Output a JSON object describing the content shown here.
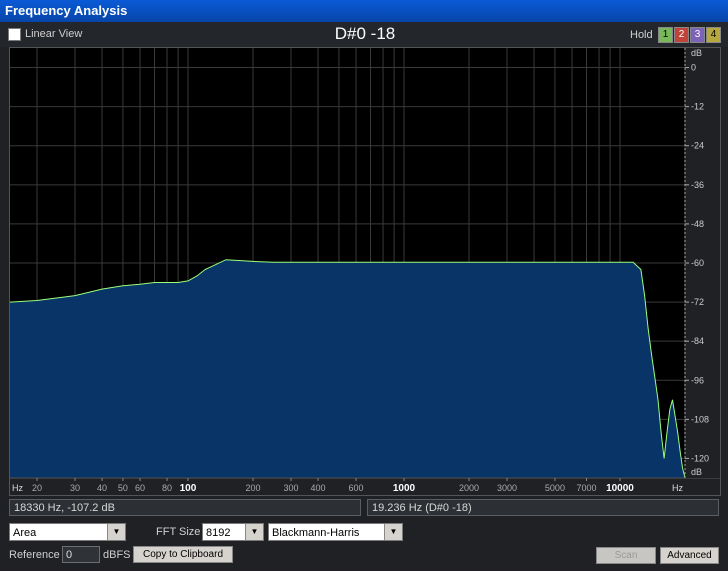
{
  "window": {
    "title": "Frequency Analysis"
  },
  "toolbar": {
    "linear_view_label": "Linear View",
    "note_readout": "D#0 -18",
    "hold_label": "Hold",
    "hold_buttons": [
      "1",
      "2",
      "3",
      "4"
    ]
  },
  "plot": {
    "x_unit_left": "Hz",
    "x_unit_right": "Hz",
    "y_unit_top": "dB",
    "y_unit_bottom": "dB",
    "x_ticks": [
      "20",
      "30",
      "40",
      "50",
      "60",
      "80",
      "100",
      "200",
      "300",
      "400",
      "600",
      "1000",
      "2000",
      "3000",
      "5000",
      "7000",
      "10000"
    ],
    "y_ticks": [
      "0",
      "-12",
      "-24",
      "-36",
      "-48",
      "-60",
      "-72",
      "-84",
      "-96",
      "-108",
      "-120"
    ],
    "colors": {
      "fill": "#083468",
      "line": "#9bff7a",
      "grid": "#3a3a3a"
    }
  },
  "chart_data": {
    "type": "area",
    "x_scale": "log",
    "xlim": [
      15,
      20000
    ],
    "ylim": [
      -126,
      6
    ],
    "x": [
      15,
      20,
      30,
      40,
      50,
      60,
      70,
      80,
      90,
      100,
      110,
      120,
      150,
      200,
      250,
      300,
      400,
      600,
      1000,
      2000,
      4000,
      7000,
      10000,
      11500,
      12500,
      13000,
      13500,
      14000,
      14500,
      15000,
      15500,
      16000,
      16500,
      17000,
      17500,
      18000,
      18500,
      19000,
      19500,
      20000
    ],
    "y": [
      -72,
      -71.5,
      -70,
      -68,
      -67,
      -66.5,
      -66,
      -66,
      -66,
      -65.5,
      -64,
      -62,
      -59,
      -59.5,
      -59.8,
      -59.8,
      -59.8,
      -59.8,
      -59.8,
      -59.8,
      -59.8,
      -59.8,
      -59.8,
      -59.8,
      -62,
      -70,
      -80,
      -88,
      -95,
      -102,
      -112,
      -120,
      -112,
      -105,
      -102,
      -107,
      -112,
      -118,
      -123,
      -126
    ]
  },
  "status": {
    "cursor": "18330 Hz, -107.2 dB",
    "peak": "19.236 Hz (D#0 -18)"
  },
  "controls": {
    "display_mode": "Area",
    "fft_size_label": "FFT Size",
    "fft_size": "8192",
    "window_function": "Blackmann-Harris",
    "reference_label": "Reference",
    "reference_value": "0",
    "reference_unit": "dBFS",
    "copy_label": "Copy to Clipboard",
    "scan_label": "Scan",
    "advanced_label": "Advanced"
  }
}
